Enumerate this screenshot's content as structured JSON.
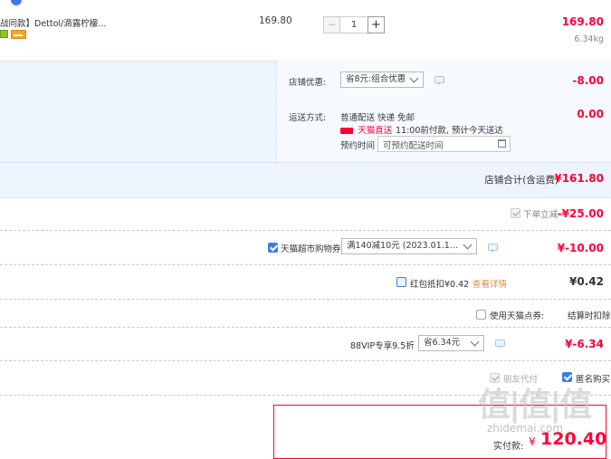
{
  "colors": {
    "accent_red": "#ff0036",
    "band_blue": "#eef4fd",
    "link_orange": "#e08a3c",
    "checkbox_blue": "#3d7de5"
  },
  "product": {
    "title": "战同款】Dettol/滴露柠檬...",
    "unit_price": "169.80",
    "quantity": "1",
    "decrement_label": "−",
    "increment_label": "+",
    "subtotal": "169.80",
    "weight": "6.34kg"
  },
  "shop_discount": {
    "label": "店铺优惠:",
    "selected": "省8元:组合优惠",
    "amount": "-8.00"
  },
  "shipping": {
    "label": "运送方式:",
    "method": "普通配送 快递 免邮",
    "badge": "天猫直送",
    "promise": "11:00前付款, 预计今天送达",
    "amount": "0.00",
    "appointment_label": "预约时间",
    "appointment_placeholder": "可预约配送时间"
  },
  "shop_total": {
    "label": "店铺合计(含运费)",
    "amount": "¥161.80"
  },
  "instant_discount": {
    "label": "下单立减",
    "amount": "-¥25.00"
  },
  "coupon": {
    "label": "天猫超市购物券",
    "selected": "满140减10元 (2023.01.1...",
    "amount": "¥-10.00"
  },
  "red_packet": {
    "label": "红包抵扣¥0.42",
    "link": "查看详情",
    "amount": "¥0.42"
  },
  "points": {
    "label": "使用天猫点券:",
    "note": "结算时扣除"
  },
  "vip": {
    "label": "88VIP专享9.5折",
    "selected": "省6.34元",
    "amount": "¥-6.34"
  },
  "options": {
    "friend_pay": "朋友代付",
    "anonymous": "匿名购买"
  },
  "payment": {
    "label": "实付款:",
    "currency": "¥",
    "amount": "120.40"
  },
  "watermark": {
    "logo": "值|值|值",
    "site": "zhidemai.com"
  }
}
